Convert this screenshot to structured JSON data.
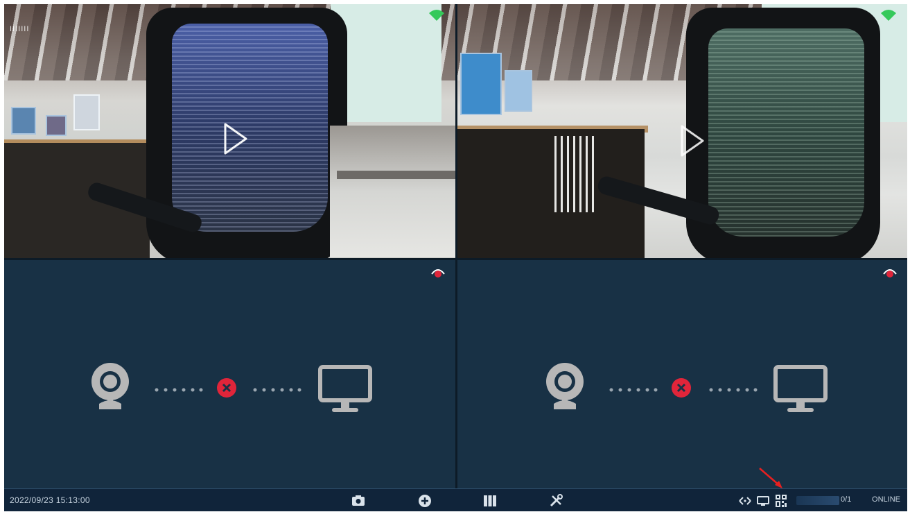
{
  "channels": [
    {
      "id": 1,
      "state": "live-video",
      "scene_tint": "blue-mesh-chair"
    },
    {
      "id": 2,
      "state": "live-video",
      "scene_tint": "green-mesh-chair"
    },
    {
      "id": 3,
      "state": "no-signal"
    },
    {
      "id": 4,
      "state": "no-signal"
    }
  ],
  "overlays": {
    "play_icon": "play-icon",
    "wifi_icon": "wifi-icon",
    "alarm_icon": "alarm-icon",
    "cam1_osd": "IIIIIII"
  },
  "no_signal": {
    "camera_icon": "webcam-icon",
    "disconnect_icon": "disconnect-x-icon",
    "monitor_icon": "monitor-icon",
    "dots": "• • • • • •"
  },
  "taskbar": {
    "datetime": "2022/09/23 15:13:00",
    "buttons": [
      {
        "name": "playback-button",
        "icon": "playback-icon"
      },
      {
        "name": "add-device-button",
        "icon": "plus-circle-icon"
      },
      {
        "name": "layout-button",
        "icon": "grid-layout-icon"
      },
      {
        "name": "settings-button",
        "icon": "tools-icon"
      }
    ],
    "right_icons": [
      "network-icon",
      "display-icon",
      "qr-code-icon"
    ],
    "ratio": "0/1",
    "status": "ONLINE"
  },
  "colors": {
    "background": "#183145",
    "taskbar": "#10243a",
    "error_red": "#e0253a",
    "icon_grey": "#b7b7b7",
    "wifi_green": "#35c95a",
    "annotation_arrow": "#e82020"
  }
}
